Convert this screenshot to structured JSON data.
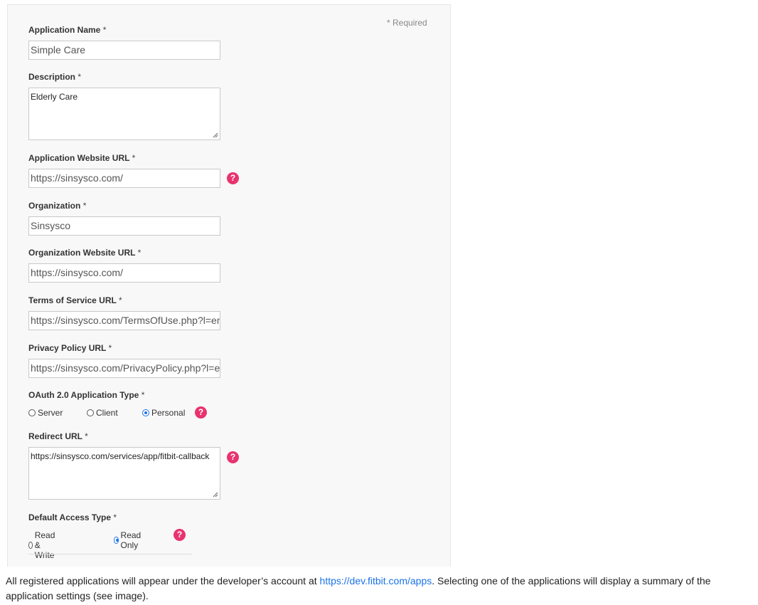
{
  "form": {
    "required_note": "* Required",
    "star": "*",
    "app_name": {
      "label": "Application Name",
      "value": "Simple Care"
    },
    "description": {
      "label": "Description",
      "value": "Elderly Care"
    },
    "app_website": {
      "label": "Application Website URL",
      "value": "https://sinsysco.com/"
    },
    "organization": {
      "label": "Organization",
      "value": "Sinsysco"
    },
    "org_website": {
      "label": "Organization Website URL",
      "value": "https://sinsysco.com/"
    },
    "tos": {
      "label": "Terms of Service URL",
      "value": "https://sinsysco.com/TermsOfUse.php?l=en"
    },
    "privacy": {
      "label": "Privacy Policy URL",
      "value": "https://sinsysco.com/PrivacyPolicy.php?l=en"
    },
    "oauth_type": {
      "label": "OAuth 2.0 Application Type",
      "options": [
        "Server",
        "Client",
        "Personal"
      ],
      "selected": "Personal"
    },
    "redirect": {
      "label": "Redirect URL",
      "value": "https://sinsysco.com/services/app/fitbit-callback"
    },
    "access_type": {
      "label": "Default Access Type",
      "options": [
        "Read & Write",
        "Read Only"
      ],
      "selected": "Read Only"
    },
    "help_glyph": "?"
  },
  "paragraph": {
    "before": "All registered applications will appear under the developer’s account at ",
    "link": "https://dev.fitbit.com/apps",
    "after": ". Selecting one of the applications will display a summary of the application settings (see image)."
  },
  "colors": {
    "help_icon": "#e8336f",
    "link": "#1a73e8",
    "panel_bg": "#f8f8f8"
  },
  "icons": {
    "help": "question-circle-icon",
    "resize": "resize-grip-icon"
  }
}
